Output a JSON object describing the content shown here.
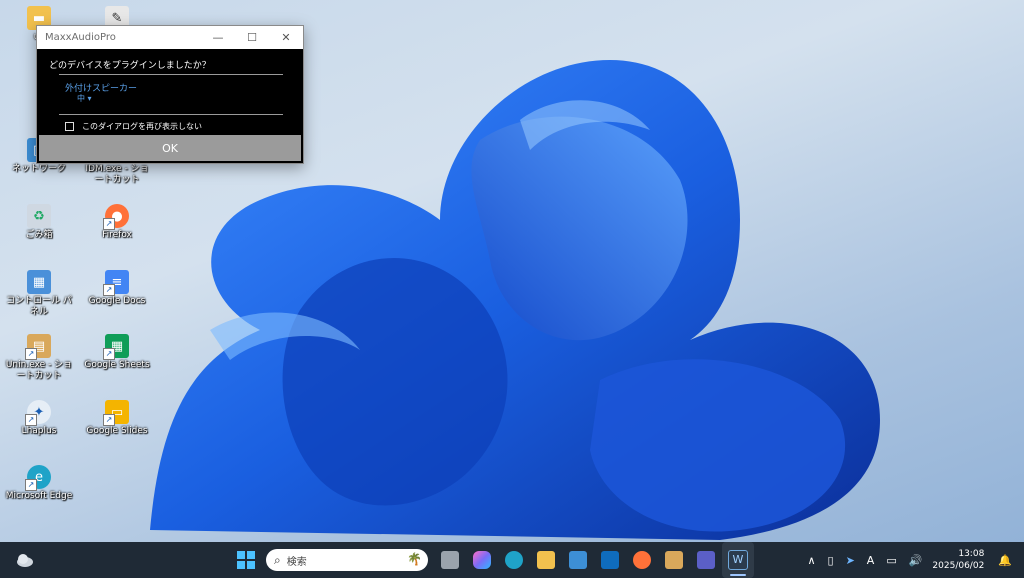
{
  "desktop_icons": [
    {
      "label": "us",
      "icon": "folder-icon",
      "color": "#f2c14e"
    },
    {
      "label": "",
      "icon": "notepad-icon",
      "color": "#e8e8e8"
    },
    {
      "label": "ネットワーク",
      "icon": "network-icon",
      "color": "#3d8fd6"
    },
    {
      "label": "IDM.exe - ショートカット",
      "icon": "idm-icon",
      "color": "#5c9ad6"
    },
    {
      "label": "ごみ箱",
      "icon": "recycle-bin-icon",
      "color": "#cfd8e2"
    },
    {
      "label": "Firefox",
      "icon": "firefox-icon",
      "color": "#ff7139"
    },
    {
      "label": "コントロール パネル",
      "icon": "control-panel-icon",
      "color": "#4a90d9"
    },
    {
      "label": "Google Docs",
      "icon": "google-docs-icon",
      "color": "#4285f4"
    },
    {
      "label": "Unin.exe - ショートカット",
      "icon": "uninstaller-icon",
      "color": "#d9a85b"
    },
    {
      "label": "Google Sheets",
      "icon": "google-sheets-icon",
      "color": "#0f9d58"
    },
    {
      "label": "Lhaplus",
      "icon": "lhaplus-icon",
      "color": "#e6eef6"
    },
    {
      "label": "Google Slides",
      "icon": "google-slides-icon",
      "color": "#f4b400"
    },
    {
      "label": "Microsoft Edge",
      "icon": "edge-icon",
      "color": "#1fa3c8"
    }
  ],
  "dialog": {
    "title": "MaxxAudioPro",
    "question": "どのデバイスをプラグインしましたか？",
    "option_main": "外付けスピーカー",
    "option_sub": "中 ▾",
    "checkbox_label": "このダイアログを再び表示しない",
    "ok_label": "OK",
    "minimize": "—",
    "maximize": "☐",
    "close": "✕"
  },
  "taskbar": {
    "search_placeholder": "検索",
    "apps": [
      {
        "name": "task-view",
        "color": "#9aa3ad"
      },
      {
        "name": "copilot",
        "color": "#7b6cf6"
      },
      {
        "name": "edge",
        "color": "#1fa3c8"
      },
      {
        "name": "file-explorer",
        "color": "#f2c14e"
      },
      {
        "name": "microsoft-store",
        "color": "#3d8fd6"
      },
      {
        "name": "outlook",
        "color": "#0f6cbd"
      },
      {
        "name": "firefox",
        "color": "#ff7139"
      },
      {
        "name": "archive-tool",
        "color": "#d9a85b"
      },
      {
        "name": "teams",
        "color": "#5b5fc7"
      },
      {
        "name": "waves-maxxaudio",
        "color": "#2b3b4d"
      }
    ],
    "tray_chevron": "∧",
    "ime_mode": "A",
    "time": "13:08",
    "date": "2025/06/02"
  },
  "colors": {
    "taskbar_bg": "#1f2a36",
    "bloom_blue": "#1c62e0",
    "dialog_accent": "#5aa0e8"
  }
}
